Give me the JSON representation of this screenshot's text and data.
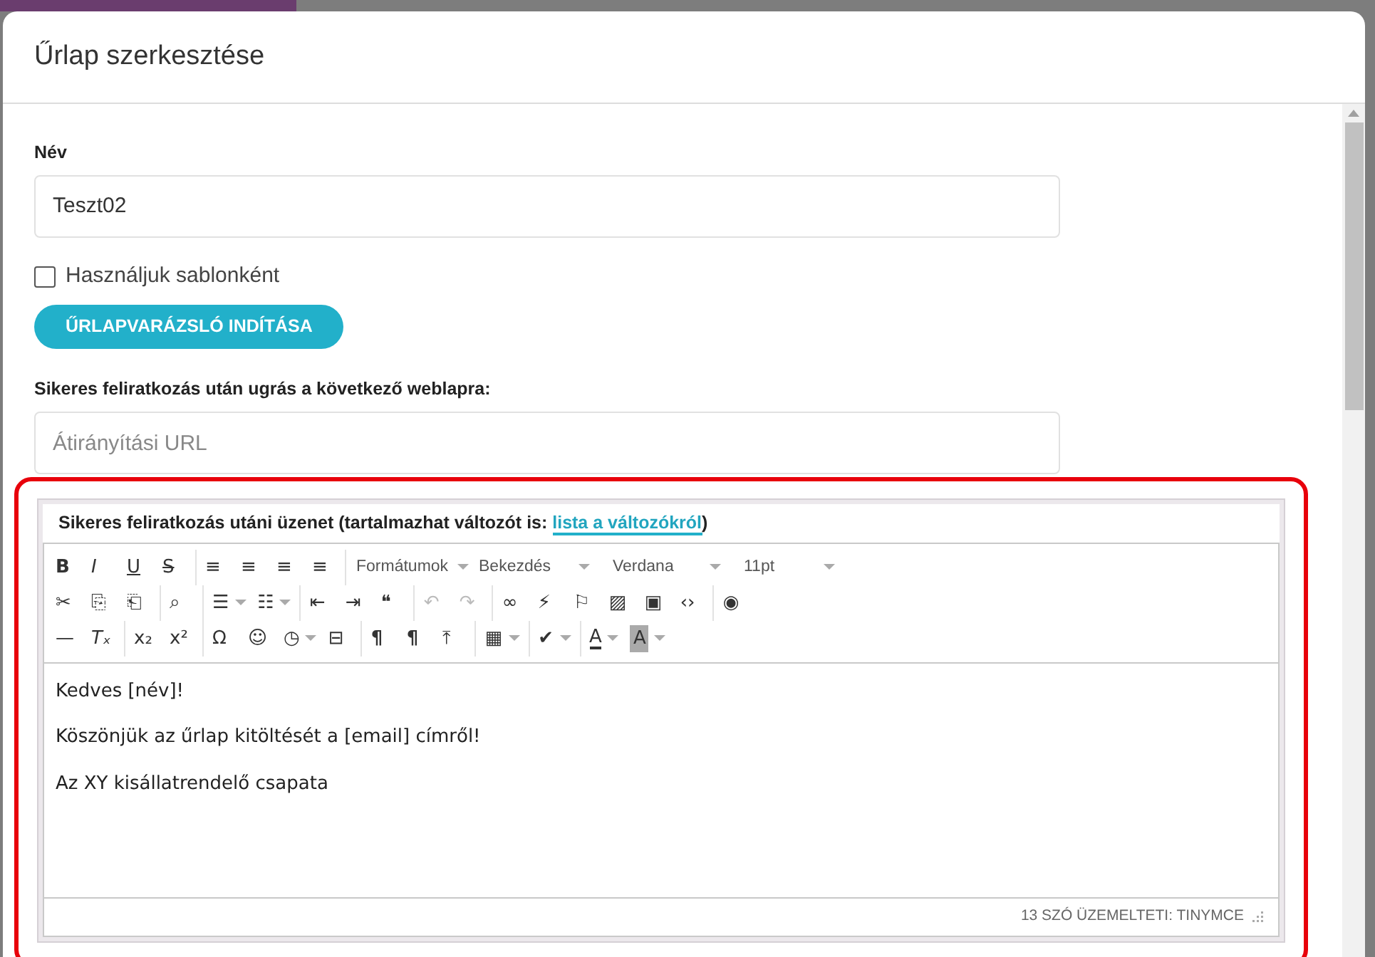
{
  "modal": {
    "title": "Űrlap szerkesztése"
  },
  "form": {
    "name_label": "Név",
    "name_value": "Teszt02",
    "template_checkbox": {
      "label": "Használjuk sablonként",
      "checked": false
    },
    "wizard_button": "ŰRLAPVARÁZSLÓ INDÍTÁSA",
    "redirect_label": "Sikeres feliratkozás után ugrás a következő weblapra:",
    "redirect_placeholder": "Átirányítási URL"
  },
  "editor": {
    "label": "Sikeres feliratkozás utáni üzenet (tartalmazhat változót is: ",
    "label_link": "lista a változókról",
    "label_end": ")",
    "toolbar": [
      [
        [
          {
            "kind": "button",
            "glyph": "B",
            "disabled": false
          },
          {
            "kind": "button",
            "glyph": "I",
            "disabled": false
          },
          {
            "kind": "button",
            "glyph": "U",
            "disabled": false
          },
          {
            "kind": "button",
            "glyph": "S",
            "disabled": false
          }
        ],
        [
          {
            "kind": "button",
            "glyph": "≡",
            "disabled": false
          },
          {
            "kind": "button",
            "glyph": "≡",
            "disabled": false
          },
          {
            "kind": "button",
            "glyph": "≡",
            "disabled": false
          },
          {
            "kind": "button",
            "glyph": "≡",
            "disabled": false
          }
        ],
        [
          {
            "kind": "select",
            "label": "Formátumok",
            "disabled": false
          },
          {
            "kind": "select",
            "label": "Bekezdés",
            "disabled": false
          },
          {
            "kind": "select",
            "label": "Verdana",
            "disabled": false
          },
          {
            "kind": "select",
            "label": "11pt",
            "disabled": false
          }
        ]
      ],
      [
        [
          {
            "kind": "button",
            "glyph": "✂",
            "disabled": false
          },
          {
            "kind": "button",
            "glyph": "⎘",
            "disabled": false
          },
          {
            "kind": "button",
            "glyph": "⎗",
            "disabled": false
          }
        ],
        [
          {
            "kind": "button",
            "glyph": "⌕",
            "disabled": false
          }
        ],
        [
          {
            "kind": "split",
            "glyph": "☰",
            "disabled": false
          },
          {
            "kind": "split",
            "glyph": "☷",
            "disabled": false
          }
        ],
        [
          {
            "kind": "button",
            "glyph": "⇤",
            "disabled": false
          },
          {
            "kind": "button",
            "glyph": "⇥",
            "disabled": false
          },
          {
            "kind": "button",
            "glyph": "❝",
            "disabled": false
          }
        ],
        [
          {
            "kind": "button",
            "glyph": "↶",
            "disabled": true
          },
          {
            "kind": "button",
            "glyph": "↷",
            "disabled": true
          }
        ],
        [
          {
            "kind": "button",
            "glyph": "∞",
            "disabled": false
          },
          {
            "kind": "button",
            "glyph": "⚡",
            "disabled": false
          },
          {
            "kind": "button",
            "glyph": "⚐",
            "disabled": false
          },
          {
            "kind": "button",
            "glyph": "▨",
            "disabled": false
          },
          {
            "kind": "button",
            "glyph": "▣",
            "disabled": false
          },
          {
            "kind": "button",
            "glyph": "‹›",
            "disabled": false
          }
        ],
        [
          {
            "kind": "button",
            "glyph": "◉",
            "disabled": false
          }
        ]
      ],
      [
        [
          {
            "kind": "button",
            "glyph": "—",
            "disabled": false
          },
          {
            "kind": "button",
            "glyph": "Tₓ",
            "disabled": false
          }
        ],
        [
          {
            "kind": "button",
            "glyph": "x₂",
            "disabled": false
          },
          {
            "kind": "button",
            "glyph": "x²",
            "disabled": false
          }
        ],
        [
          {
            "kind": "button",
            "glyph": "Ω",
            "disabled": false
          },
          {
            "kind": "button",
            "glyph": "☺",
            "disabled": false
          },
          {
            "kind": "split",
            "glyph": "◷",
            "disabled": false
          },
          {
            "kind": "button",
            "glyph": "⊟",
            "disabled": false
          }
        ],
        [
          {
            "kind": "button",
            "glyph": "¶",
            "disabled": false
          },
          {
            "kind": "button",
            "glyph": "¶",
            "disabled": false
          },
          {
            "kind": "button",
            "glyph": "⤒",
            "disabled": false
          }
        ],
        [
          {
            "kind": "split",
            "glyph": "▦",
            "disabled": false
          }
        ],
        [
          {
            "kind": "split",
            "glyph": "✔",
            "disabled": false
          }
        ],
        [
          {
            "kind": "split",
            "glyph": "A",
            "disabled": false
          },
          {
            "kind": "split",
            "glyph": "A",
            "disabled": false
          }
        ]
      ]
    ],
    "paragraphs": [
      "Kedves [név]!",
      "Köszönjük az űrlap kitöltését a [email] címről!",
      "Az XY kisállatrendelő csapata"
    ],
    "status": "13 SZÓ ÜZEMELTETI: TINYMCE"
  }
}
